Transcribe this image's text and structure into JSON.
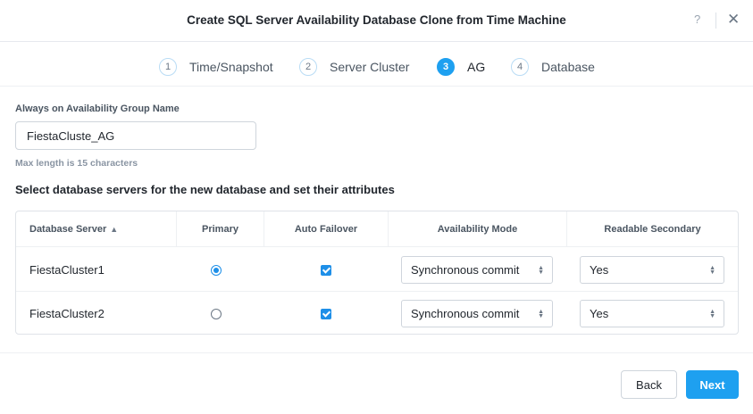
{
  "dialog": {
    "title": "Create SQL Server Availability Database Clone from Time Machine",
    "help_label": "?",
    "close_label": "✕"
  },
  "steps": [
    {
      "number": "1",
      "label": "Time/Snapshot",
      "active": false
    },
    {
      "number": "2",
      "label": "Server Cluster",
      "active": false
    },
    {
      "number": "3",
      "label": "AG",
      "active": true
    },
    {
      "number": "4",
      "label": "Database",
      "active": false
    }
  ],
  "ag_group": {
    "label": "Always on Availability Group Name",
    "value": "FiestaCluste_AG",
    "hint": "Max length is 15 characters"
  },
  "servers_section": {
    "title": "Select database servers for the new database and set their attributes"
  },
  "table": {
    "headers": {
      "server": "Database Server",
      "primary": "Primary",
      "auto_failover": "Auto Failover",
      "availability_mode": "Availability Mode",
      "readable_secondary": "Readable Secondary"
    },
    "rows": [
      {
        "server": "FiestaCluster1",
        "primary": true,
        "auto_failover": true,
        "availability_mode": "Synchronous commit",
        "readable_secondary": "Yes"
      },
      {
        "server": "FiestaCluster2",
        "primary": false,
        "auto_failover": true,
        "availability_mode": "Synchronous commit",
        "readable_secondary": "Yes"
      }
    ]
  },
  "footer": {
    "back_label": "Back",
    "next_label": "Next"
  },
  "colors": {
    "accent": "#1ea0f0",
    "text": "#22272e",
    "muted": "#8a95a3"
  }
}
